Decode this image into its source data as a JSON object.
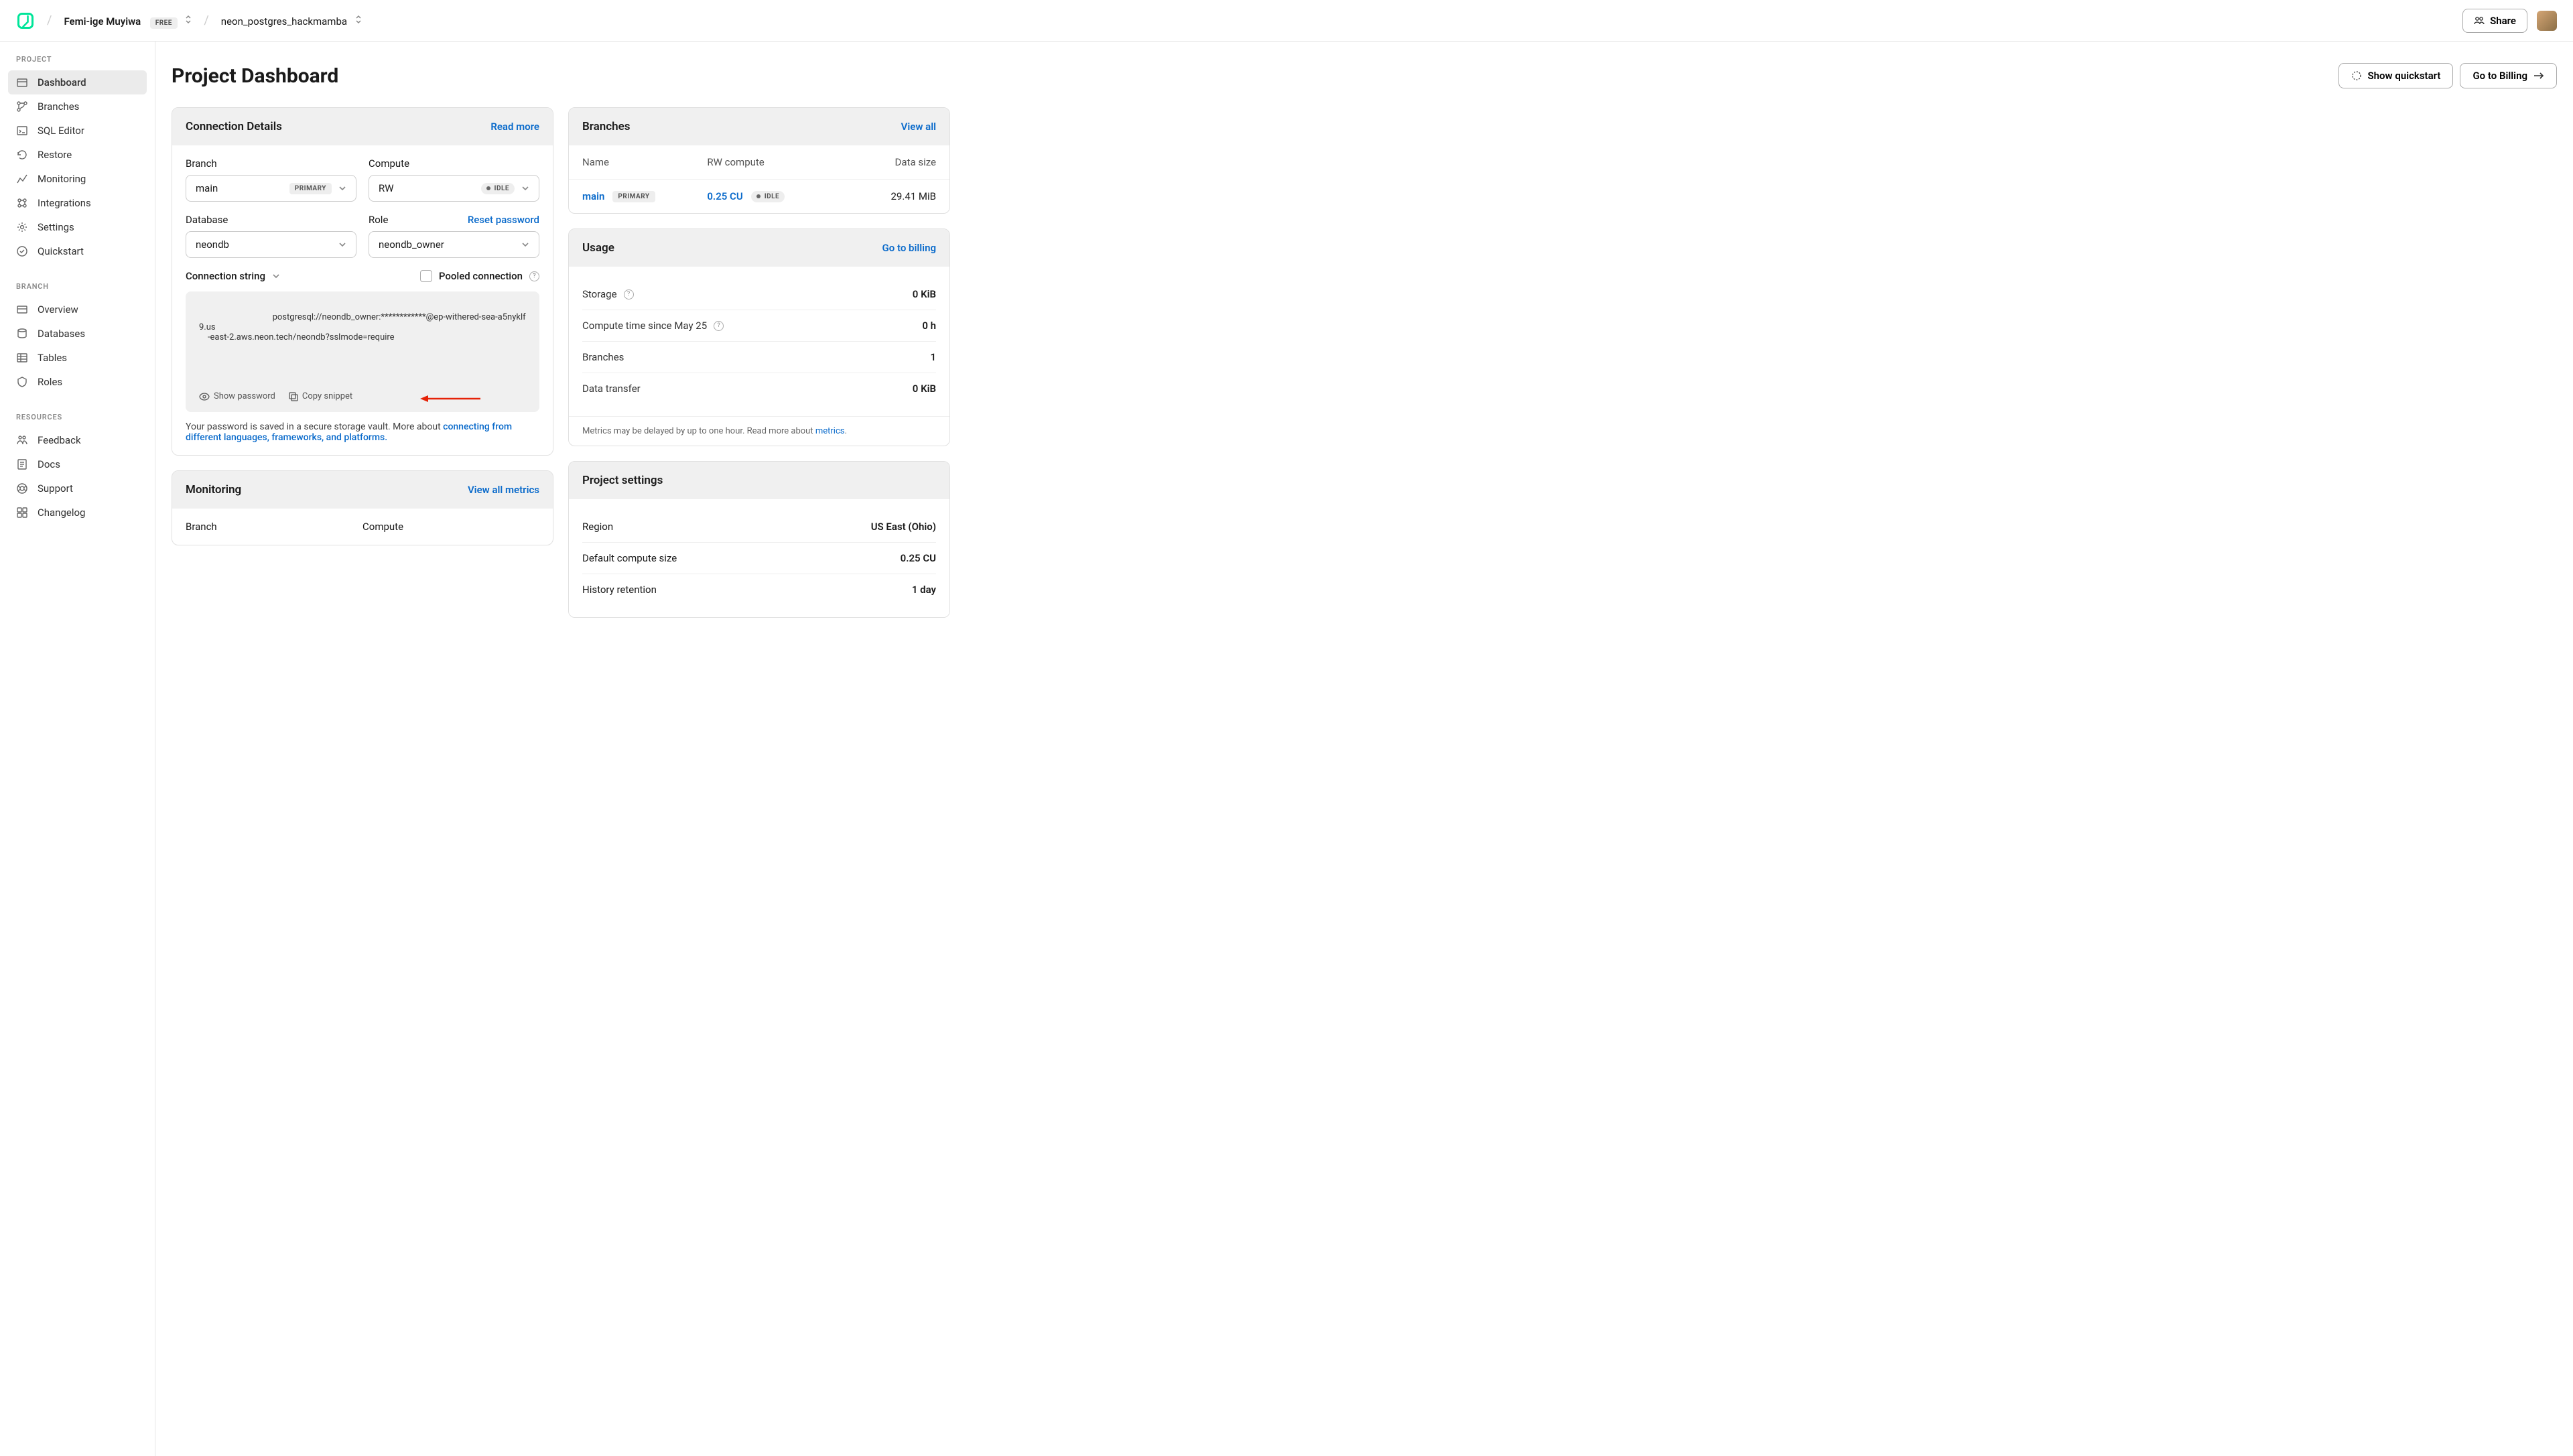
{
  "topbar": {
    "org_name": "Femi-ige Muyiwa",
    "tier": "FREE",
    "project_name": "neon_postgres_hackmamba",
    "share_label": "Share"
  },
  "sidebar": {
    "section_project": "PROJECT",
    "section_branch": "BRANCH",
    "section_resources": "RESOURCES",
    "project_items": [
      {
        "icon": "dashboard",
        "label": "Dashboard",
        "active": true
      },
      {
        "icon": "branches",
        "label": "Branches"
      },
      {
        "icon": "sql",
        "label": "SQL Editor"
      },
      {
        "icon": "restore",
        "label": "Restore"
      },
      {
        "icon": "monitoring",
        "label": "Monitoring"
      },
      {
        "icon": "integrations",
        "label": "Integrations"
      },
      {
        "icon": "settings",
        "label": "Settings"
      },
      {
        "icon": "quickstart",
        "label": "Quickstart"
      }
    ],
    "branch_items": [
      {
        "icon": "overview",
        "label": "Overview"
      },
      {
        "icon": "databases",
        "label": "Databases"
      },
      {
        "icon": "tables",
        "label": "Tables"
      },
      {
        "icon": "roles",
        "label": "Roles"
      }
    ],
    "resource_items": [
      {
        "icon": "feedback",
        "label": "Feedback"
      },
      {
        "icon": "docs",
        "label": "Docs"
      },
      {
        "icon": "support",
        "label": "Support"
      },
      {
        "icon": "changelog",
        "label": "Changelog"
      }
    ]
  },
  "page": {
    "title": "Project Dashboard",
    "show_quickstart": "Show quickstart",
    "go_to_billing": "Go to Billing"
  },
  "connection": {
    "title": "Connection Details",
    "read_more": "Read more",
    "branch_label": "Branch",
    "branch_value": "main",
    "branch_badge": "PRIMARY",
    "compute_label": "Compute",
    "compute_value": "RW",
    "compute_status": "IDLE",
    "database_label": "Database",
    "database_value": "neondb",
    "role_label": "Role",
    "role_value": "neondb_owner",
    "reset_password": "Reset password",
    "conn_string_label": "Connection string",
    "pooled_label": "Pooled connection",
    "connection_string": "postgresql://neondb_owner:************@ep-withered-sea-a5nyklf9.us-east-2.aws.neon.tech/neondb?sslmode=require",
    "show_password": "Show password",
    "copy_snippet": "Copy snippet",
    "hint_prefix": "Your password is saved in a secure storage vault. More about ",
    "hint_link": "connecting from different languages, frameworks, and platforms."
  },
  "monitoring_card": {
    "title": "Monitoring",
    "view_all": "View all metrics",
    "branch_col": "Branch",
    "compute_col": "Compute"
  },
  "branches_card": {
    "title": "Branches",
    "view_all": "View all",
    "th_name": "Name",
    "th_rw": "RW compute",
    "th_size": "Data size",
    "row": {
      "name": "main",
      "badge": "PRIMARY",
      "cu": "0.25 CU",
      "status": "IDLE",
      "size": "29.41 MiB"
    }
  },
  "usage_card": {
    "title": "Usage",
    "go_to_billing": "Go to billing",
    "items": [
      {
        "label": "Storage",
        "help": true,
        "value": "0 KiB"
      },
      {
        "label": "Compute time since May 25",
        "help": true,
        "value": "0 h"
      },
      {
        "label": "Branches",
        "help": false,
        "value": "1"
      },
      {
        "label": "Data transfer",
        "help": false,
        "value": "0 KiB"
      }
    ],
    "note_prefix": "Metrics may be delayed by up to one hour. Read more about ",
    "note_link": "metrics",
    "note_suffix": "."
  },
  "settings_card": {
    "title": "Project settings",
    "items": [
      {
        "label": "Region",
        "value": "US East (Ohio)"
      },
      {
        "label": "Default compute size",
        "value": "0.25 CU"
      },
      {
        "label": "History retention",
        "value": "1 day"
      }
    ]
  }
}
